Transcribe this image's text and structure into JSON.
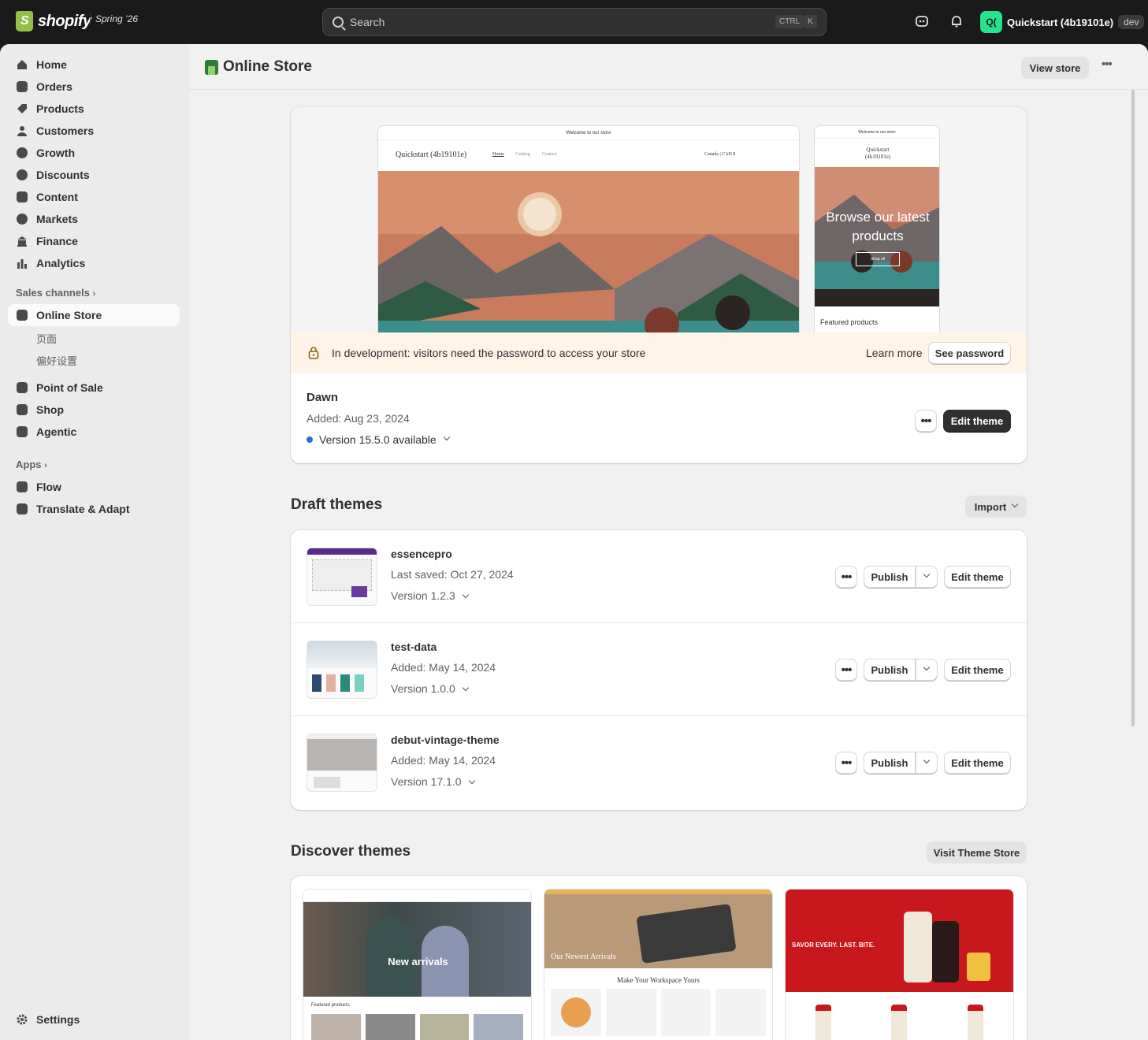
{
  "topbar": {
    "logo_text": "shopify",
    "release": "Spring ’26",
    "search_placeholder": "Search",
    "kbd1": "CTRL",
    "kbd2": "K",
    "avatar_initials": "Q(",
    "store_name": "Quickstart (4b19101e)",
    "env_badge": "dev"
  },
  "sidebar": {
    "main": [
      {
        "label": "Home",
        "icon": "home-icon"
      },
      {
        "label": "Orders",
        "icon": "inbox-icon"
      },
      {
        "label": "Products",
        "icon": "tag-icon"
      },
      {
        "label": "Customers",
        "icon": "person-icon"
      },
      {
        "label": "Growth",
        "icon": "gauge-icon"
      },
      {
        "label": "Discounts",
        "icon": "discount-icon"
      },
      {
        "label": "Content",
        "icon": "content-icon"
      },
      {
        "label": "Markets",
        "icon": "globe-icon"
      },
      {
        "label": "Finance",
        "icon": "bank-icon"
      },
      {
        "label": "Analytics",
        "icon": "chart-bar-icon"
      }
    ],
    "sales_channels_label": "Sales channels",
    "online_store": "Online Store",
    "online_store_sub": [
      "页面",
      "偏好设置"
    ],
    "channels": [
      {
        "label": "Point of Sale",
        "icon": "pos-icon"
      },
      {
        "label": "Shop",
        "icon": "shop-icon"
      },
      {
        "label": "Agentic",
        "icon": "agentic-icon"
      }
    ],
    "apps_label": "Apps",
    "apps": [
      {
        "label": "Flow",
        "icon": "flow-icon"
      },
      {
        "label": "Translate & Adapt",
        "icon": "translate-icon"
      }
    ],
    "settings": "Settings"
  },
  "page": {
    "title": "Online Store",
    "view_store": "View store"
  },
  "current_theme": {
    "preview_banner": "Welcome to our store",
    "preview_store_name": "Quickstart (4b19101e)",
    "preview_nav": [
      "Home",
      "Catalog",
      "Contact"
    ],
    "preview_currency": "Canada | CAD $",
    "mobile_store_name": "Quickstart (4b19101e)",
    "mobile_hero": "Browse our latest products",
    "mobile_shop_all": "Shop all",
    "mobile_featured": "Featured products",
    "dev_notice": "In development: visitors need the password to access your store",
    "learn_more": "Learn more",
    "see_password": "See password",
    "name": "Dawn",
    "added": "Added: Aug 23, 2024",
    "version": "Version 15.5.0 available",
    "edit_theme": "Edit theme"
  },
  "draft_themes": {
    "heading": "Draft themes",
    "import": "Import",
    "publish": "Publish",
    "edit_theme": "Edit theme",
    "items": [
      {
        "name": "essencepro",
        "meta": "Last saved: Oct 27, 2024",
        "version": "Version 1.2.3"
      },
      {
        "name": "test-data",
        "meta": "Added: May 14, 2024",
        "version": "Version 1.0.0"
      },
      {
        "name": "debut-vintage-theme",
        "meta": "Added: May 14, 2024",
        "version": "Version 17.1.0"
      }
    ]
  },
  "discover": {
    "heading": "Discover themes",
    "visit_store": "Visit Theme Store",
    "cards": [
      {
        "hero_text": "New arrivals",
        "sub": "Featured products"
      },
      {
        "hero_text": "Our Newest Arrivals",
        "sub": "Make Your Workspace Yours"
      },
      {
        "hero_text": "SAVOR EVERY. LAST. BITE.",
        "sub": ""
      }
    ]
  },
  "colors": {
    "accent": "#303030",
    "sidebar_bg": "#ebebeb",
    "notice_bg": "#fff4e8",
    "version_dot": "#2c6ecb"
  }
}
